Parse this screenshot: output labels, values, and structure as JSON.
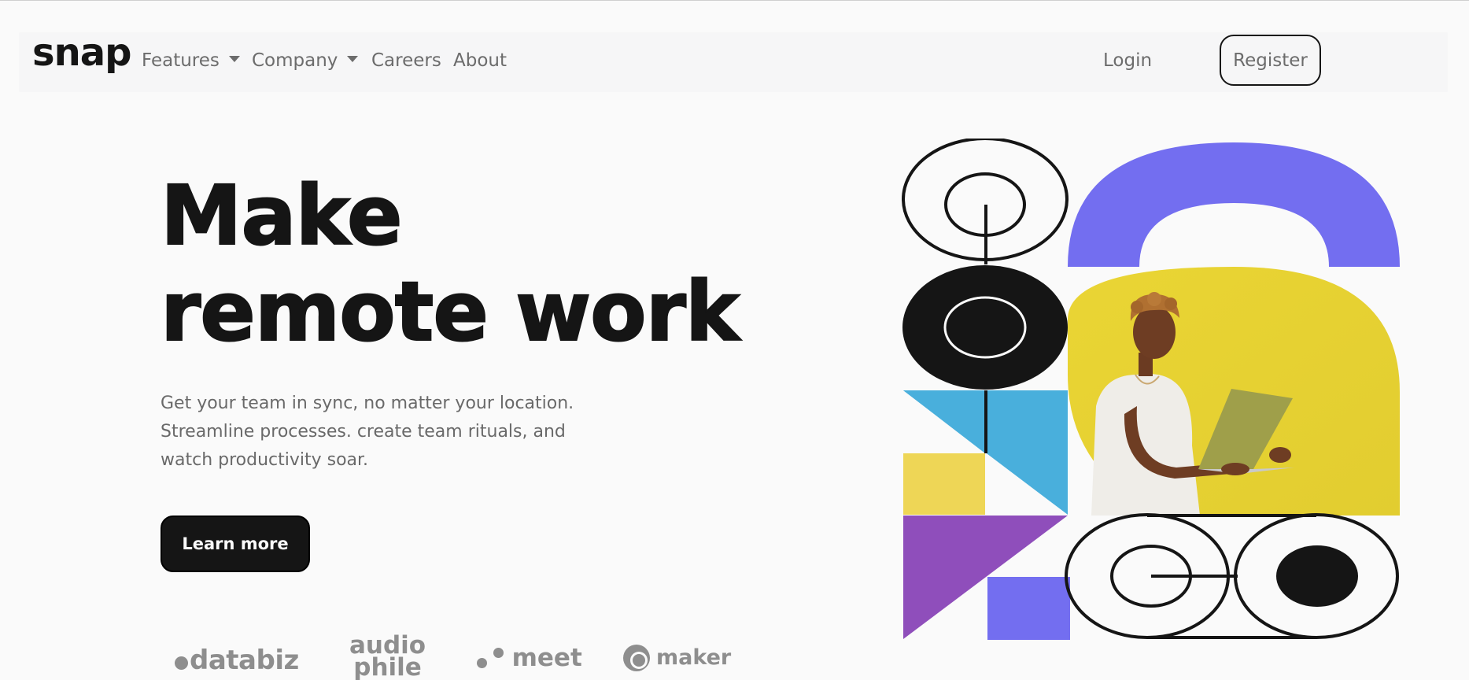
{
  "nav": {
    "logo": "snap",
    "features_label": "Features",
    "company_label": "Company",
    "careers_label": "Careers",
    "about_label": "About",
    "login_label": "Login",
    "register_label": "Register"
  },
  "hero": {
    "title_line1": "Make",
    "title_line2": "remote work",
    "description": "Get your team in sync, no matter your location. Streamline processes. create team rituals, and watch productivity soar.",
    "cta_label": "Learn more"
  },
  "clients": {
    "databiz": "databiz",
    "audiophile_top": "audio",
    "audiophile_bottom": "phile",
    "meet": "meet",
    "maker": "maker"
  },
  "colors": {
    "background": "#fafafa",
    "text_dark": "#151515",
    "text_gray": "#696969",
    "art_purple": "#736ef0",
    "art_yellow": "#e6d235",
    "art_blue": "#49afdc",
    "art_violet": "#8f4ebb",
    "art_light_yellow": "#eed656"
  },
  "icons": [
    "caret-down-icon",
    "databiz-logo",
    "audiophile-logo",
    "meet-logo",
    "maker-logo"
  ]
}
